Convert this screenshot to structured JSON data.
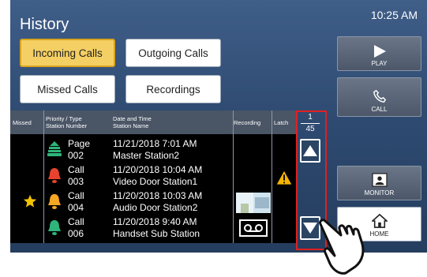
{
  "header": {
    "title": "History",
    "time": "10:25 AM"
  },
  "tabs": [
    {
      "label": "Incoming Calls",
      "active": true
    },
    {
      "label": "Outgoing Calls",
      "active": false
    },
    {
      "label": "Missed Calls",
      "active": false
    },
    {
      "label": "Recordings",
      "active": false
    }
  ],
  "table": {
    "columns": {
      "missed": "Missed",
      "priority_line1": "Priority / Type",
      "priority_line2": "Station Number",
      "datetime_line1": "Date and Time",
      "datetime_line2": "Station Name",
      "recording": "Recording",
      "latch": "Latch"
    },
    "rows": [
      {
        "type": "Page",
        "number": "002",
        "datetime": "11/21/2018 7:01 AM",
        "station": "Master Station2",
        "icon": "page-speaker-icon",
        "icon_color": "#2fb57a",
        "missed": false,
        "recording": "",
        "latch": false
      },
      {
        "type": "Call",
        "number": "003",
        "datetime": "11/20/2018 10:04 AM",
        "station": "Video Door Station1",
        "icon": "bell-icon",
        "icon_color": "#e8432e",
        "missed": false,
        "recording": "",
        "latch": true
      },
      {
        "type": "Call",
        "number": "004",
        "datetime": "11/20/2018 10:03 AM",
        "station": "Audio Door Station2",
        "icon": "bell-icon",
        "icon_color": "#f5a623",
        "missed": true,
        "recording": "video-thumbnail",
        "latch": false
      },
      {
        "type": "Call",
        "number": "006",
        "datetime": "11/20/2018 9:40 AM",
        "station": "Handset Sub Station",
        "icon": "bell-icon",
        "icon_color": "#2fb57a",
        "missed": false,
        "recording": "voice-recording",
        "latch": false
      }
    ]
  },
  "pagination": {
    "current": "1",
    "total": "45"
  },
  "side_buttons": {
    "play": "PLAY",
    "call": "CALL",
    "monitor": "MONITOR",
    "home": "HOME"
  },
  "colors": {
    "background": "#2f4b72",
    "active_tab": "#f4cf63",
    "highlight_box": "#e02020",
    "missed_star": "#f2c200"
  }
}
